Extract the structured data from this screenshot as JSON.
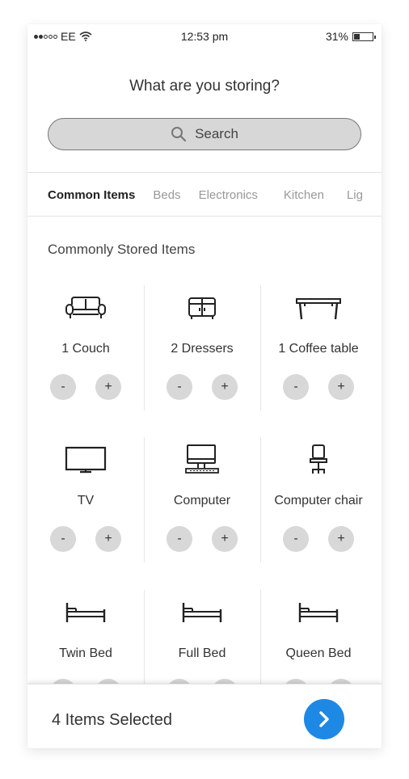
{
  "status_bar": {
    "carrier": "EE",
    "time": "12:53 pm",
    "battery": "31%",
    "battery_level": 0.31
  },
  "header": {
    "title": "What are you storing?"
  },
  "search": {
    "placeholder": "Search"
  },
  "tabs": [
    {
      "label": "Common Items"
    },
    {
      "label": "Beds"
    },
    {
      "label": "Electronics"
    },
    {
      "label": "Kitchen"
    },
    {
      "label": "Lig"
    }
  ],
  "section": {
    "title": "Commonly Stored Items"
  },
  "items": [
    {
      "label": "1 Couch",
      "icon": "couch-icon"
    },
    {
      "label": "2 Dressers",
      "icon": "dresser-icon"
    },
    {
      "label": "1 Coffee table",
      "icon": "coffee-table-icon"
    },
    {
      "label": "TV",
      "icon": "tv-icon"
    },
    {
      "label": "Computer",
      "icon": "computer-icon"
    },
    {
      "label": "Computer chair",
      "icon": "computer-chair-icon"
    },
    {
      "label": "Twin Bed",
      "icon": "bed-icon"
    },
    {
      "label": "Full Bed",
      "icon": "bed-icon"
    },
    {
      "label": "Queen Bed",
      "icon": "bed-icon"
    }
  ],
  "stepper": {
    "minus": "-",
    "plus": "+"
  },
  "footer": {
    "selected_text": "4 Items Selected",
    "accent_color": "#1e88e5"
  }
}
